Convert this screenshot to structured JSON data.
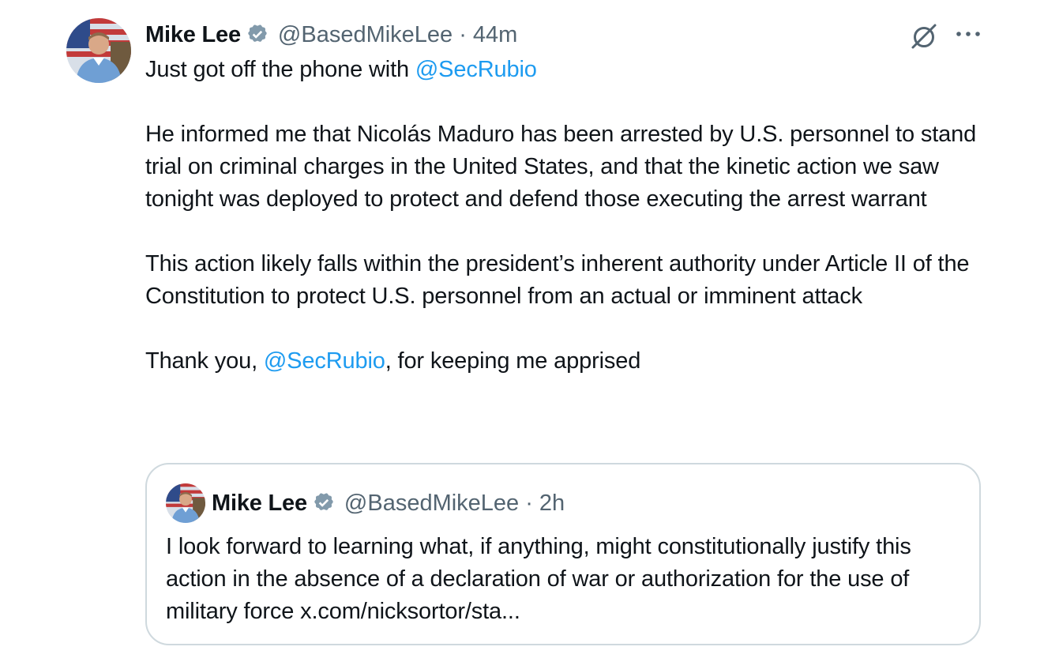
{
  "tweet": {
    "display_name": "Mike Lee",
    "handle": "@BasedMikeLee",
    "separator": "·",
    "time": "44m",
    "line1_prefix": "Just got off the phone with ",
    "line1_mention": "@SecRubio",
    "para2": "He informed me that Nicolás Maduro has been arrested by U.S. personnel to stand trial on criminal charges in the United States, and that the kinetic action we saw tonight was deployed to protect and defend those executing the arrest warrant",
    "para3": "This action likely falls within the president’s inherent authority under Article II of the Constitution to protect U.S. personnel from an actual or imminent attack",
    "para4_prefix": "Thank you, ",
    "para4_mention": "@SecRubio",
    "para4_suffix": ", for keeping me apprised"
  },
  "quote": {
    "display_name": "Mike Lee",
    "handle": "@BasedMikeLee",
    "separator": "·",
    "time": "2h",
    "text": "I look forward to learning what, if anything, might constitutionally justify this action in the absence of a declaration of war or authorization for the use of military force x.com/nicksortor/sta..."
  },
  "icons": {
    "verified": "verified-badge-icon",
    "grok": "grok-icon",
    "more": "more-options-icon"
  },
  "colors": {
    "link": "#1d9bf0",
    "secondary_text": "#536471",
    "primary_text": "#0f1419",
    "border": "#cfd9de",
    "verified_badge": "#829aab"
  }
}
